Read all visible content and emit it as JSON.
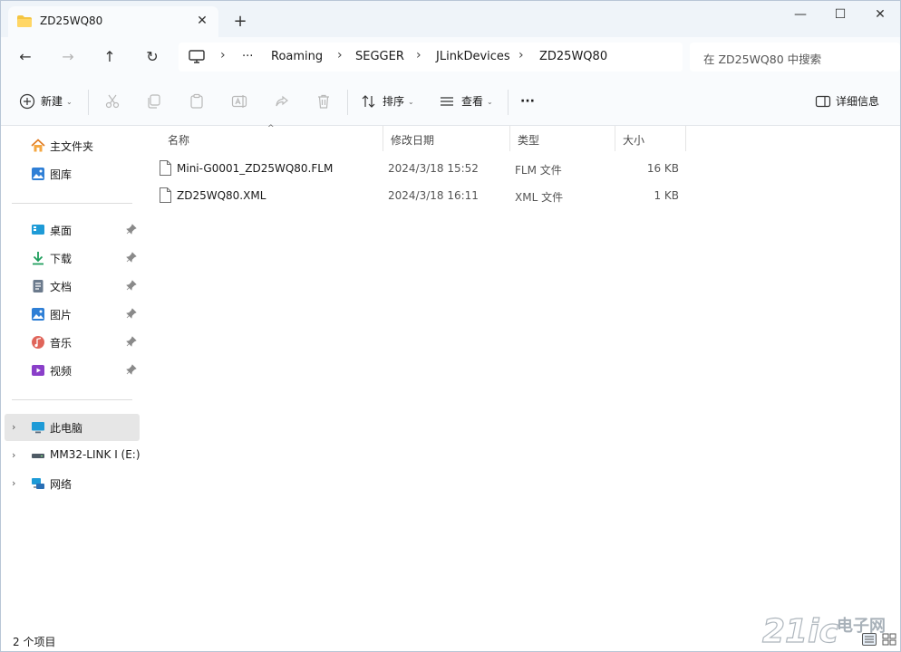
{
  "window": {
    "tab_title": "ZD25WQ80",
    "new_tab_symbol": "+",
    "controls": {
      "minimize": "—",
      "maximize": "☐",
      "close": "✕"
    }
  },
  "navigation": {
    "back": "←",
    "forward": "→",
    "up": "↑",
    "refresh": "↻",
    "breadcrumb_overflow": "···",
    "breadcrumbs": [
      "Roaming",
      "SEGGER",
      "JLinkDevices",
      "ZD25WQ80"
    ],
    "search_placeholder": "在 ZD25WQ80 中搜索"
  },
  "toolbar": {
    "new_label": "新建",
    "sort_label": "排序",
    "view_label": "查看",
    "more_label": "···",
    "details_label": "详细信息"
  },
  "sidebar": {
    "top_items": [
      {
        "label": "主文件夹",
        "icon": "home-icon"
      },
      {
        "label": "图库",
        "icon": "gallery-icon"
      }
    ],
    "pinned_items": [
      {
        "label": "桌面",
        "icon": "desktop-icon"
      },
      {
        "label": "下载",
        "icon": "download-icon"
      },
      {
        "label": "文档",
        "icon": "documents-icon"
      },
      {
        "label": "图片",
        "icon": "pictures-icon"
      },
      {
        "label": "音乐",
        "icon": "music-icon"
      },
      {
        "label": "视频",
        "icon": "videos-icon"
      }
    ],
    "drives": [
      {
        "label": "此电脑",
        "icon": "this-pc-icon",
        "selected": true
      },
      {
        "label": "MM32-LINK I (E:)",
        "icon": "usb-drive-icon"
      },
      {
        "label": "网络",
        "icon": "network-icon"
      }
    ]
  },
  "file_list": {
    "columns": [
      "名称",
      "修改日期",
      "类型",
      "大小"
    ],
    "rows": [
      {
        "name": "Mini-G0001_ZD25WQ80.FLM",
        "modified": "2024/3/18 15:52",
        "type": "FLM 文件",
        "size": "16 KB"
      },
      {
        "name": "ZD25WQ80.XML",
        "modified": "2024/3/18 16:11",
        "type": "XML 文件",
        "size": "1 KB"
      }
    ]
  },
  "status": {
    "item_count": "2 个项目"
  },
  "watermark": {
    "text": "21ic 电子网"
  },
  "colors": {
    "accent": "#0067c0",
    "folder": "#f4c542",
    "selected_bg": "#e6e6e6"
  }
}
